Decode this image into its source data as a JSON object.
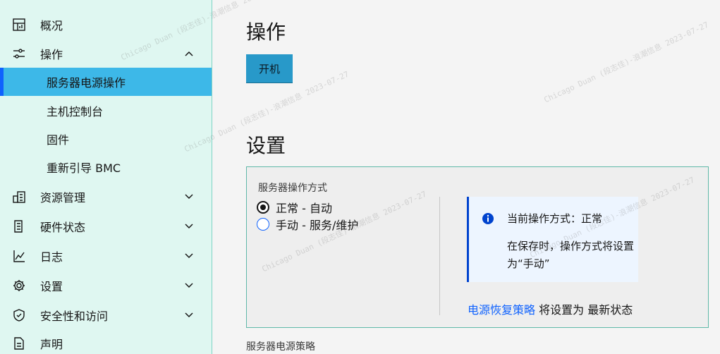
{
  "sidebar": {
    "items": [
      {
        "label": "概况",
        "icon": "dashboard-icon"
      },
      {
        "label": "操作",
        "icon": "sliders-icon",
        "expanded": true
      },
      {
        "label": "资源管理",
        "icon": "resource-icon"
      },
      {
        "label": "硬件状态",
        "icon": "hardware-icon"
      },
      {
        "label": "日志",
        "icon": "chart-log-icon"
      },
      {
        "label": "设置",
        "icon": "gear-icon"
      },
      {
        "label": "安全性和访问",
        "icon": "shield-check-icon"
      },
      {
        "label": "声明",
        "icon": "document-icon"
      }
    ],
    "sub_items": [
      {
        "label": "服务器电源操作",
        "active": true
      },
      {
        "label": "主机控制台"
      },
      {
        "label": "固件"
      },
      {
        "label": "重新引导 BMC"
      }
    ]
  },
  "main": {
    "operations_heading": "操作",
    "power_button_label": "开机",
    "settings_heading": "设置",
    "mode_label": "服务器操作方式",
    "mode_options": [
      {
        "label": "正常 - 自动",
        "selected": true
      },
      {
        "label": "手动 - 服务/维护",
        "selected": false
      }
    ],
    "notice": {
      "title": "当前操作方式：正常",
      "body": "在保存时，操作方式将设置为“手动”"
    },
    "policy_link": "电源恢复策略",
    "policy_text": " 将设置为 最新状态",
    "bottom_label": "服务器电源策略"
  },
  "watermark": "Chicago Duan (段志佳)-浪潮信息 2023-07-27",
  "colors": {
    "sidebar_bg": "#dff7f1",
    "active_item_bg": "#3db8e8",
    "accent": "#0f62fe",
    "button_bg": "#2899c9"
  }
}
